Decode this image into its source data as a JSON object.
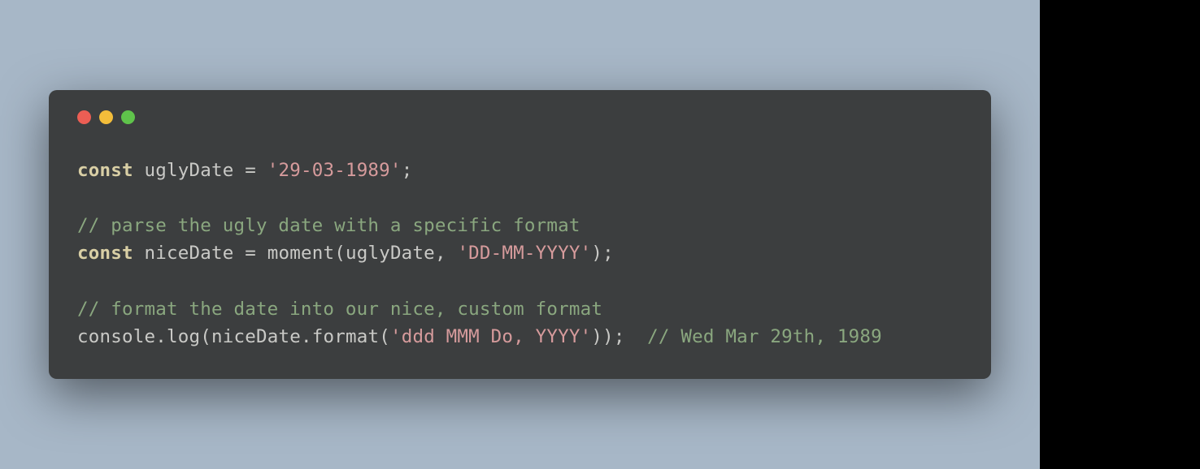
{
  "code": {
    "lines": [
      {
        "tokens": [
          {
            "t": "const",
            "c": "keyword"
          },
          {
            "t": " ",
            "c": "ident"
          },
          {
            "t": "uglyDate",
            "c": "ident"
          },
          {
            "t": " ",
            "c": "ident"
          },
          {
            "t": "=",
            "c": "op"
          },
          {
            "t": " ",
            "c": "ident"
          },
          {
            "t": "'29-03-1989'",
            "c": "string"
          },
          {
            "t": ";",
            "c": "punct"
          }
        ]
      },
      {
        "tokens": [
          {
            "t": "",
            "c": "ident"
          }
        ]
      },
      {
        "tokens": [
          {
            "t": "// parse the ugly date with a specific format",
            "c": "comment"
          }
        ]
      },
      {
        "tokens": [
          {
            "t": "const",
            "c": "keyword"
          },
          {
            "t": " ",
            "c": "ident"
          },
          {
            "t": "niceDate",
            "c": "ident"
          },
          {
            "t": " ",
            "c": "ident"
          },
          {
            "t": "=",
            "c": "op"
          },
          {
            "t": " ",
            "c": "ident"
          },
          {
            "t": "moment",
            "c": "func"
          },
          {
            "t": "(",
            "c": "punct"
          },
          {
            "t": "uglyDate",
            "c": "ident"
          },
          {
            "t": ", ",
            "c": "punct"
          },
          {
            "t": "'DD-MM-YYYY'",
            "c": "string"
          },
          {
            "t": ")",
            "c": "punct"
          },
          {
            "t": ";",
            "c": "punct"
          }
        ]
      },
      {
        "tokens": [
          {
            "t": "",
            "c": "ident"
          }
        ]
      },
      {
        "tokens": [
          {
            "t": "// format the date into our nice, custom format",
            "c": "comment"
          }
        ]
      },
      {
        "tokens": [
          {
            "t": "console",
            "c": "ident"
          },
          {
            "t": ".",
            "c": "punct"
          },
          {
            "t": "log",
            "c": "func"
          },
          {
            "t": "(",
            "c": "punct"
          },
          {
            "t": "niceDate",
            "c": "ident"
          },
          {
            "t": ".",
            "c": "punct"
          },
          {
            "t": "format",
            "c": "func"
          },
          {
            "t": "(",
            "c": "punct"
          },
          {
            "t": "'ddd MMM Do, YYYY'",
            "c": "string"
          },
          {
            "t": ")",
            "c": "punct"
          },
          {
            "t": ")",
            "c": "punct"
          },
          {
            "t": ";",
            "c": "punct"
          },
          {
            "t": "  ",
            "c": "ident"
          },
          {
            "t": "// Wed Mar 29th, 1989",
            "c": "comment"
          }
        ]
      }
    ]
  }
}
